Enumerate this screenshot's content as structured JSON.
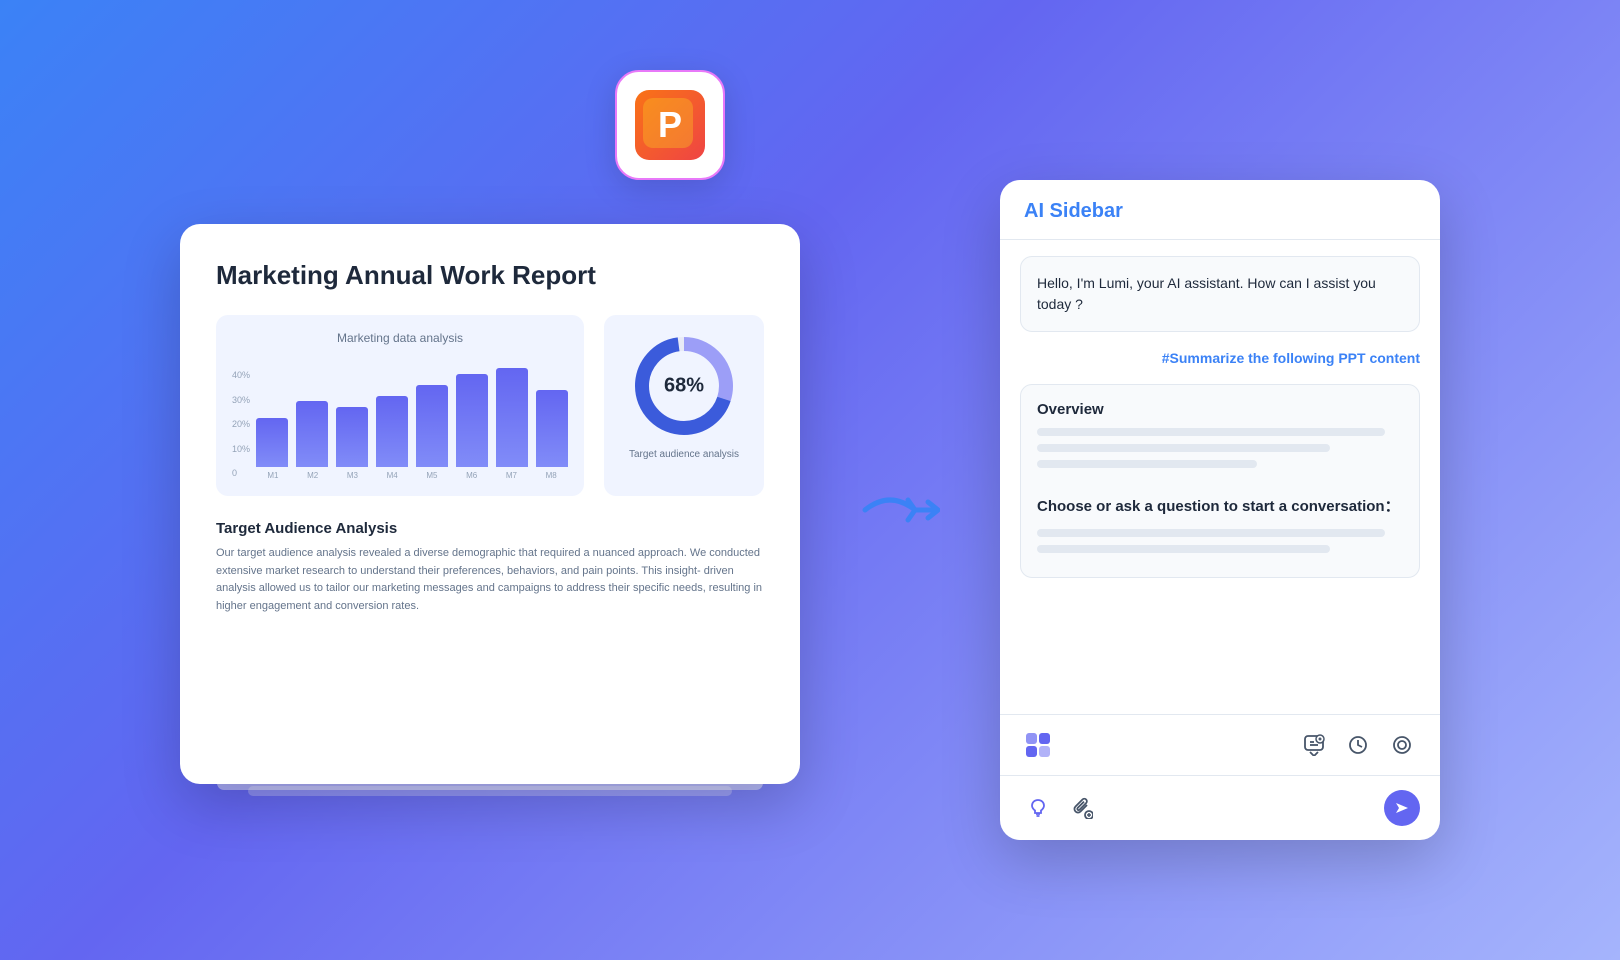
{
  "background": {
    "gradient_start": "#3b82f6",
    "gradient_end": "#a5b4fc"
  },
  "ppt_icon": {
    "letter": "P",
    "border_color": "#e879f9"
  },
  "slide": {
    "title": "Marketing Annual Work Report",
    "bar_chart_title": "Marketing data analysis",
    "bar_data": [
      {
        "label": "M1",
        "height_pct": 45
      },
      {
        "label": "M2",
        "height_pct": 60
      },
      {
        "label": "M3",
        "height_pct": 55
      },
      {
        "label": "M4",
        "height_pct": 65
      },
      {
        "label": "M5",
        "height_pct": 75
      },
      {
        "label": "M6",
        "height_pct": 85
      },
      {
        "label": "M7",
        "height_pct": 90
      },
      {
        "label": "M8",
        "height_pct": 70
      }
    ],
    "y_labels": [
      "40%",
      "30%",
      "20%",
      "10%",
      "0"
    ],
    "donut_value": "68%",
    "donut_caption": "Target audience analysis",
    "audience_title": "Target Audience Analysis",
    "audience_text": "Our target audience analysis revealed a diverse demographic that required a nuanced approach. We conducted extensive market research to understand their preferences, behaviors, and pain points. This insight- driven analysis allowed us to tailor our marketing messages and campaigns to address their specific needs, resulting in higher engagement and conversion rates."
  },
  "ai_sidebar": {
    "title": "AI Sidebar",
    "greeting": "Hello, I'm Lumi, your AI assistant. How can I assist you today ?",
    "suggestion_chip": "#Summarize the following PPT content",
    "overview_title": "Overview",
    "conversation_prompt": "Choose or ask a question to start a conversation：",
    "toolbar": {
      "app_icon_label": "app-icon",
      "new_chat_label": "new-chat",
      "history_label": "history",
      "settings_label": "settings"
    },
    "input_area": {
      "lightbulb_label": "lightbulb",
      "attach_label": "attach",
      "send_label": "send"
    }
  }
}
